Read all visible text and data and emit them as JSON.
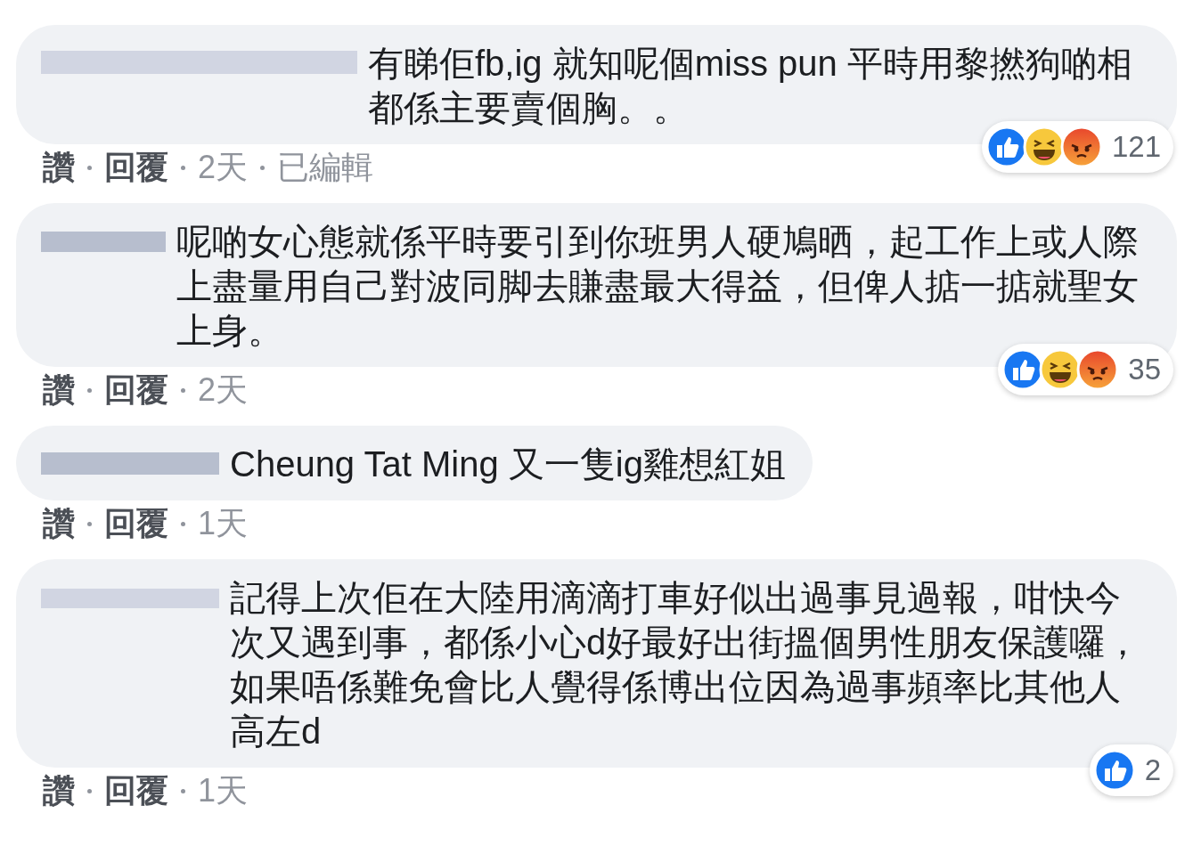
{
  "comments": [
    {
      "text": "有睇佢fb,ig 就知呢個miss pun 平時用黎撚狗啲相都係主要賣個胸。。",
      "reactions": [
        {
          "kind": "like"
        },
        {
          "kind": "haha"
        },
        {
          "kind": "angry"
        }
      ],
      "reaction_count": "121",
      "actions": [
        "讚",
        "回覆"
      ],
      "time": "2天",
      "edited": "已編輯"
    },
    {
      "text": "呢啲女心態就係平時要引到你班男人硬鳩晒，起工作上或人際上盡量用自己對波同脚去賺盡最大得益，但俾人掂一掂就聖女上身。",
      "reactions": [
        {
          "kind": "like"
        },
        {
          "kind": "haha"
        },
        {
          "kind": "angry"
        }
      ],
      "reaction_count": "35",
      "actions": [
        "讚",
        "回覆"
      ],
      "time": "2天"
    },
    {
      "text": "Cheung Tat Ming 又一隻ig雞想紅姐",
      "actions": [
        "讚",
        "回覆"
      ],
      "time": "1天"
    },
    {
      "text": "記得上次佢在大陸用滴滴打車好似出過事見過報，咁快今次又遇到事，都係小心d好最好出街搵個男性朋友保護囉，如果唔係難免會比人覺得係博出位因為過事頻率比其他人高左d",
      "reactions": [
        {
          "kind": "like"
        }
      ],
      "reaction_count": "2",
      "actions": [
        "讚",
        "回覆"
      ],
      "time": "1天"
    }
  ]
}
